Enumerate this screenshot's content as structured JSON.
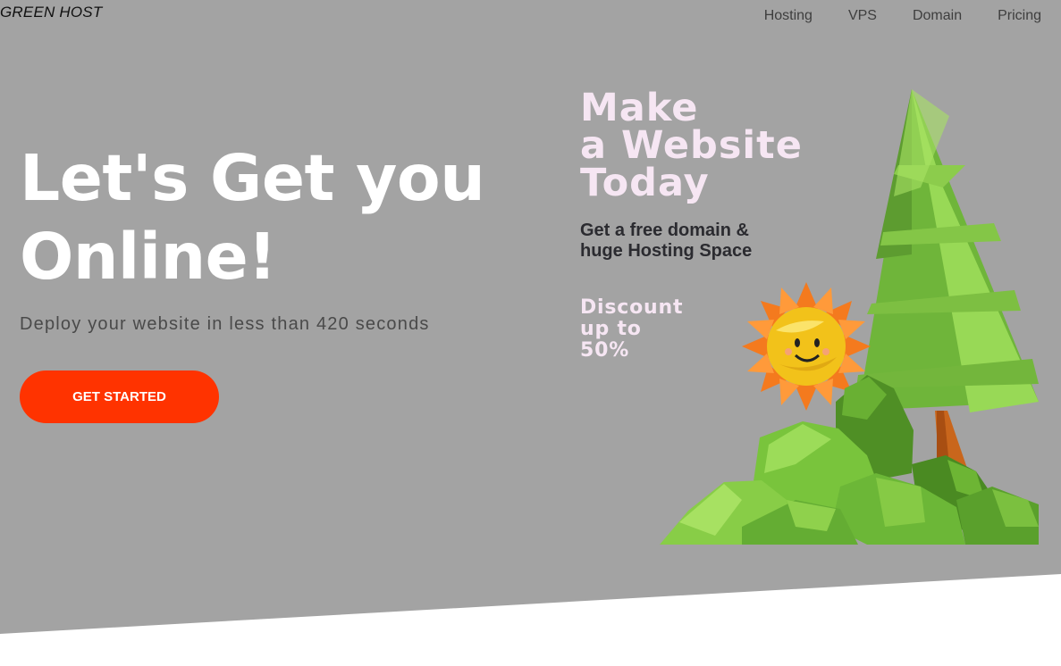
{
  "brand": {
    "logo_text": "GREEN HOST"
  },
  "nav": {
    "items": [
      "Hosting",
      "VPS",
      "Domain",
      "Pricing"
    ]
  },
  "hero": {
    "headline_line1": "Let's Get you",
    "headline_line2": "Online!",
    "subline": "Deploy your website in less than 420 seconds",
    "cta_label": "GET STARTED"
  },
  "promo": {
    "title_line1": "Make",
    "title_line2": "a Website",
    "title_line3": "Today",
    "sub_line1": "Get a free domain &",
    "sub_line2": "huge Hosting Space",
    "discount_line1": "Discount",
    "discount_line2": "up to",
    "discount_line3": "50%"
  },
  "illustration": {
    "icons": [
      "tree-icon",
      "sun-icon",
      "bushes-icon"
    ]
  },
  "colors": {
    "hero_bg": "#a3a3a3",
    "cta_bg": "#ff3300",
    "promo_text": "#f6e6f3",
    "tree_green": "#8fd34e"
  }
}
